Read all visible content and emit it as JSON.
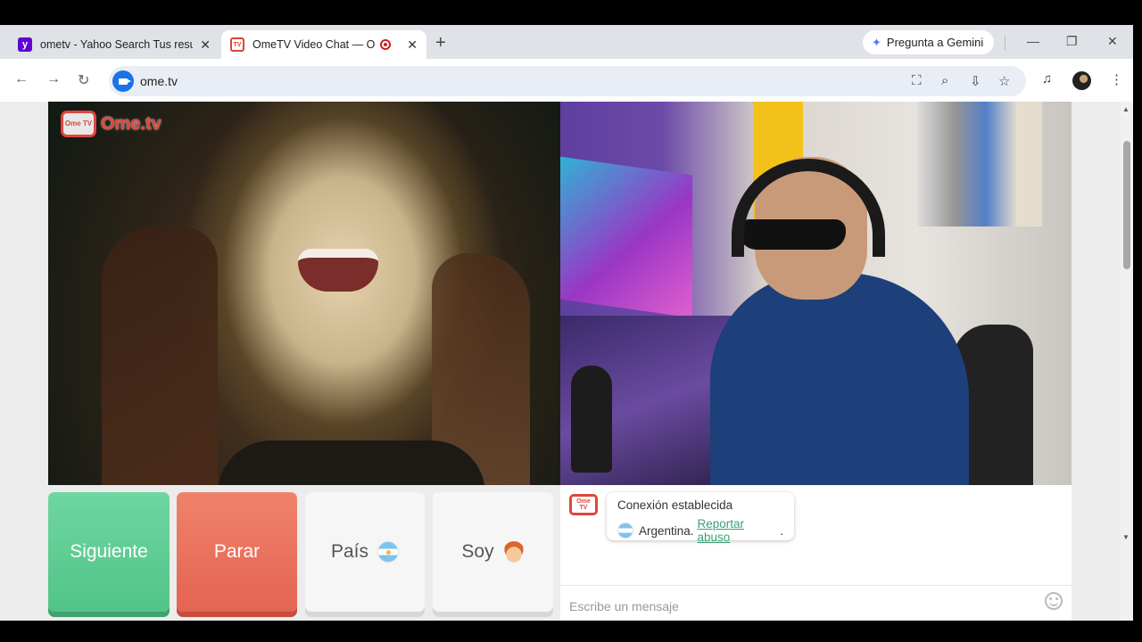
{
  "tabs": [
    {
      "title": "ometv - Yahoo Search Tus resul",
      "favicon": "yahoo-icon",
      "close": "✕"
    },
    {
      "title": "OmeTV Video Chat — Ome",
      "favicon": "ometv-icon",
      "close": "✕",
      "recording": true
    }
  ],
  "new_tab": "+",
  "gemini_label": "Pregunta a Gemini",
  "address_bar": {
    "url": "ome.tv"
  },
  "logo": {
    "tv_text": "Ome TV",
    "brand": "Ome.tv"
  },
  "controls": {
    "next_label": "Siguiente",
    "stop_label": "Parar",
    "country_label": "País",
    "gender_label": "Soy"
  },
  "chat": {
    "logo_text": "Ome TV",
    "status": "Conexión establecida",
    "country": "Argentina.",
    "report_link": "Reportar abuso",
    "report_suffix": ".",
    "input_placeholder": "Escribe un mensaje"
  },
  "colors": {
    "next": "#5ccb8f",
    "stop": "#e86f59",
    "brand": "#e0463c",
    "link": "#3aa074"
  }
}
